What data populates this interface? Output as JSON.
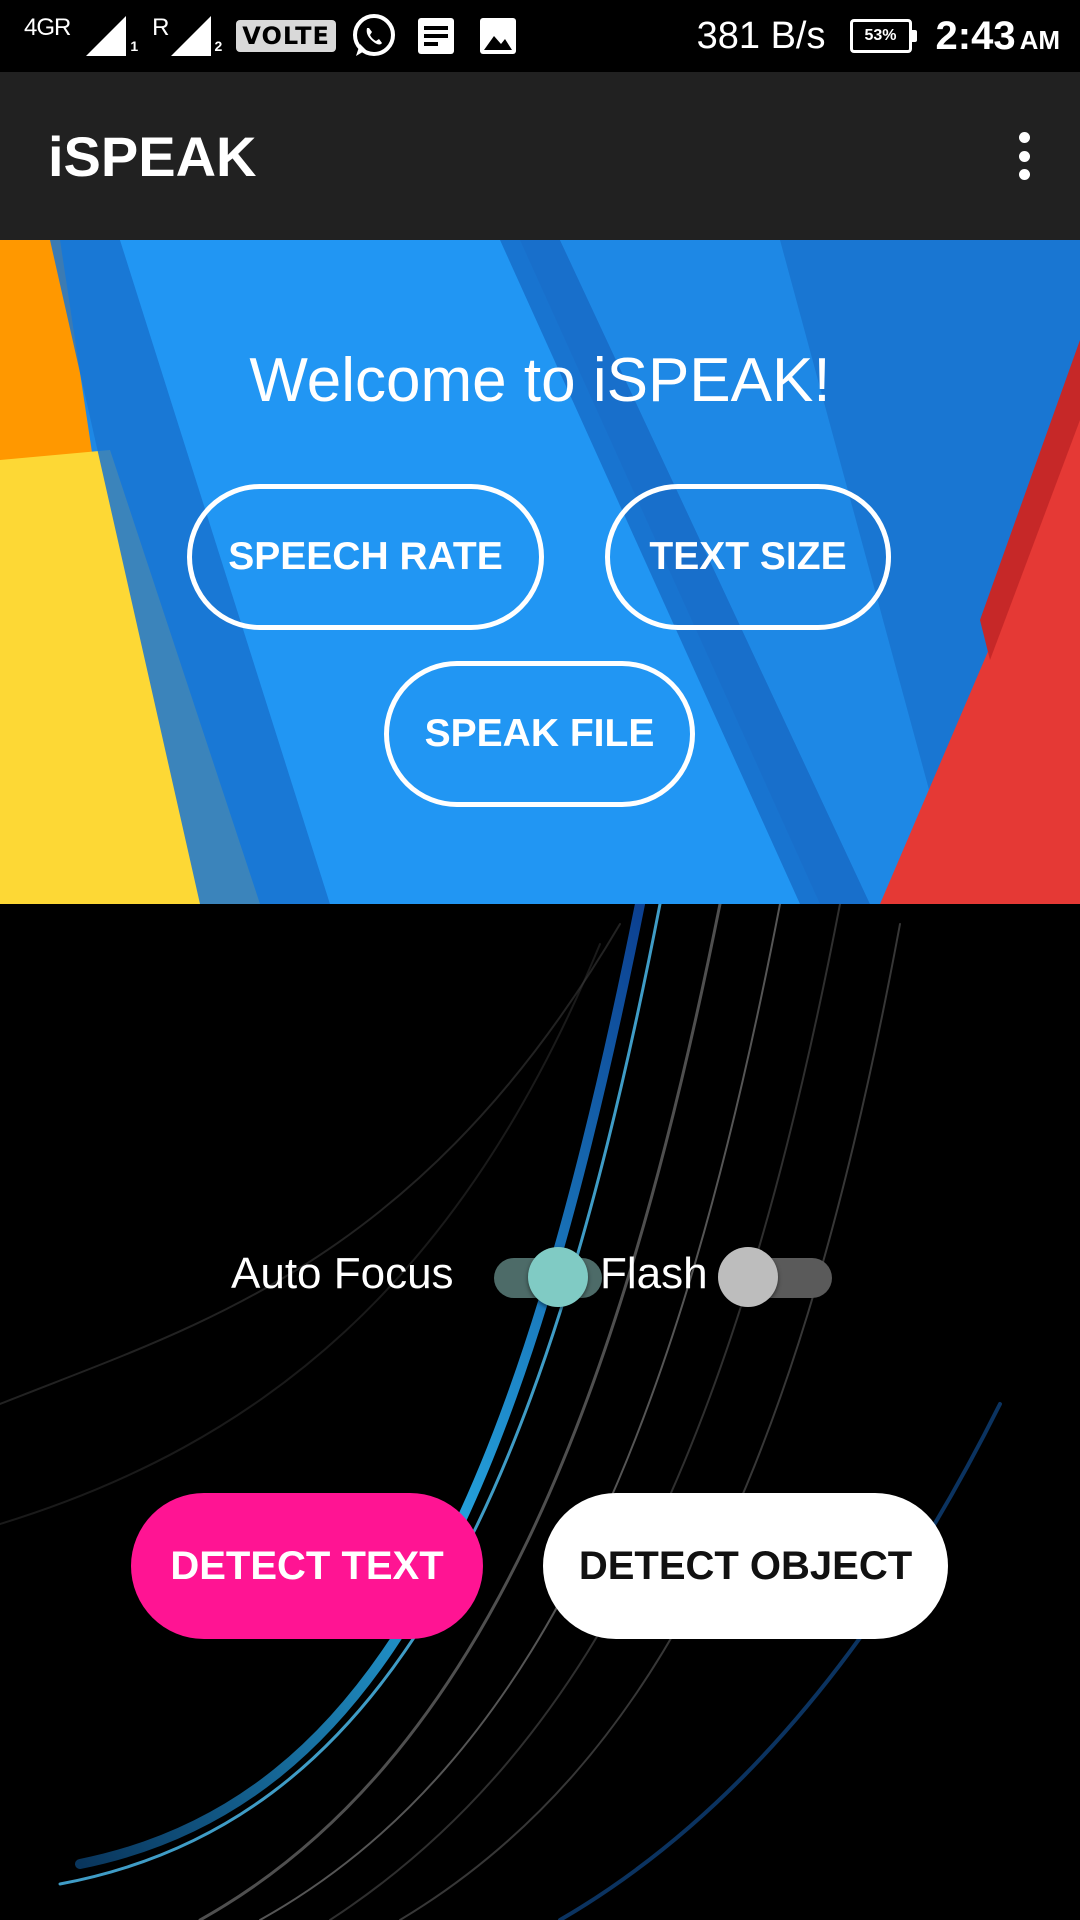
{
  "status_bar": {
    "network_type": "4GR",
    "sim1_label": "1",
    "roaming": "R",
    "sim2_label": "2",
    "volte": "VOLTE",
    "icons": [
      "whatsapp-icon",
      "notes-icon",
      "gallery-icon"
    ],
    "speed": "381 B/s",
    "battery": "53%",
    "time": "2:43",
    "ampm": "AM"
  },
  "app_bar": {
    "title": "iSPEAK",
    "menu_icon": "more-vert-icon"
  },
  "banner": {
    "welcome": "Welcome to iSPEAK!",
    "speech_rate_label": "SPEECH RATE",
    "text_size_label": "TEXT SIZE",
    "speak_file_label": "SPEAK FILE"
  },
  "controls": {
    "auto_focus_label": "Auto Focus",
    "auto_focus_on": true,
    "flash_label": "Flash",
    "flash_on": false
  },
  "actions": {
    "detect_text_label": "DETECT TEXT",
    "detect_object_label": "DETECT OBJECT"
  },
  "colors": {
    "app_bar": "#212121",
    "banner_blue": "#1e88e5",
    "toggle_on": "#80cbc4",
    "detect_text_bg": "#ff1493",
    "detect_object_bg": "#ffffff"
  }
}
